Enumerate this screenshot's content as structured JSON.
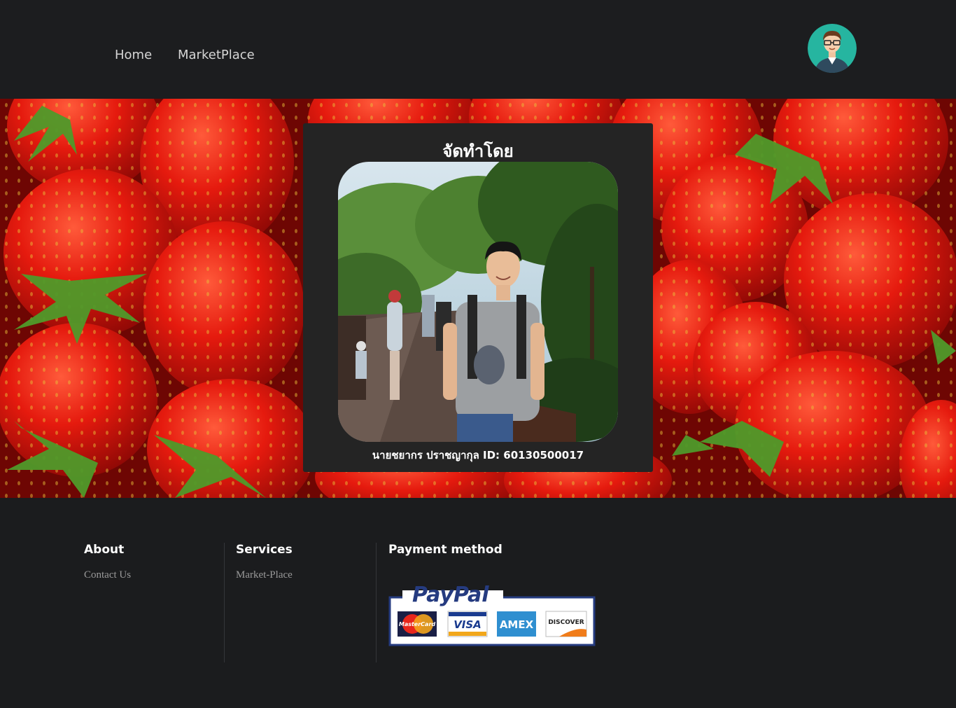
{
  "nav": {
    "home": "Home",
    "marketplace": "MarketPlace",
    "avatar_icon": "user-avatar-icon"
  },
  "card": {
    "title": "จัดทำโดย",
    "caption": "นายชยากร ปราชญากุล ID: 60130500017"
  },
  "footer": {
    "about": {
      "heading": "About",
      "link": "Contact Us"
    },
    "services": {
      "heading": "Services",
      "link": "Market-Place"
    },
    "payment": {
      "heading": "Payment method",
      "logo_text": "PayPal",
      "cards": [
        "MasterCard",
        "VISA",
        "AMEX",
        "DISCOVER"
      ]
    }
  },
  "colors": {
    "background": "#1b1c1e",
    "card": "#242424",
    "paypal_blue": "#253b80",
    "hero_red": "#d9160c"
  }
}
